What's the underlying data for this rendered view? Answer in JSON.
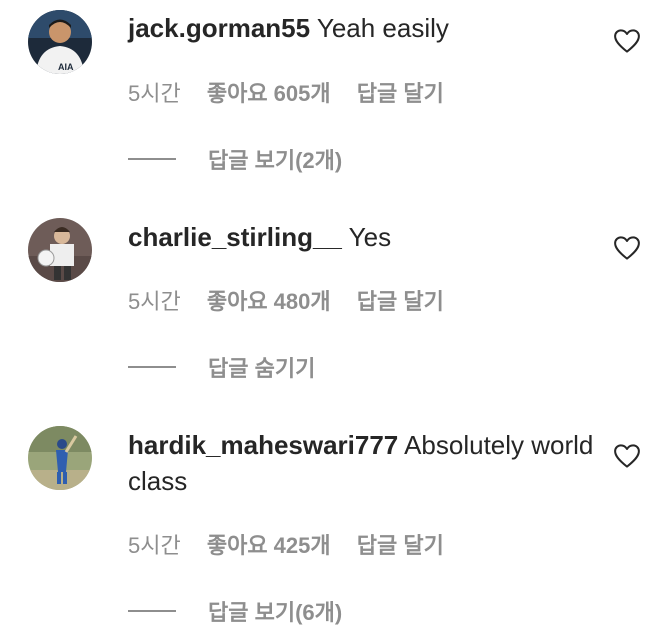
{
  "comments": [
    {
      "username": "jack.gorman55",
      "text": "Yeah easily",
      "time": "5시간",
      "likes": "좋아요 605개",
      "reply": "답글 달기",
      "replies_toggle": "답글 보기(2개)",
      "avatar_icon": "profile-photo-footballer"
    },
    {
      "username": "charlie_stirling__",
      "text": "Yes",
      "time": "5시간",
      "likes": "좋아요 480개",
      "reply": "답글 달기",
      "replies_toggle": "답글 숨기기",
      "avatar_icon": "profile-photo-vintage"
    },
    {
      "username": "hardik_maheswari777",
      "text": "Absolutely world class",
      "time": "5시간",
      "likes": "좋아요 425개",
      "reply": "답글 달기",
      "replies_toggle": "답글 보기(6개)",
      "avatar_icon": "profile-photo-cricketer"
    }
  ],
  "colors": {
    "text": "#262626",
    "secondary": "#8e8e8e"
  }
}
